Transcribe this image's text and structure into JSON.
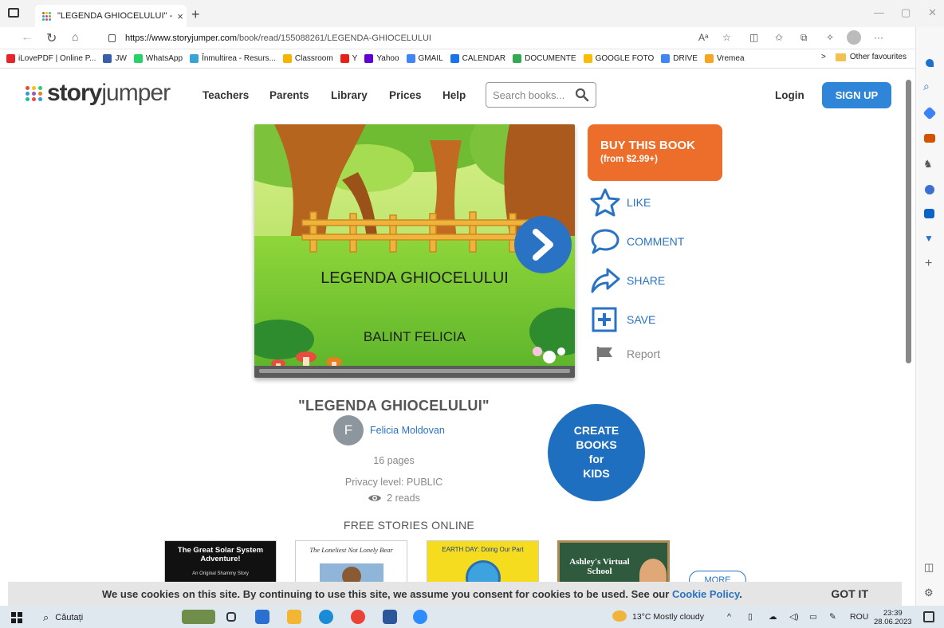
{
  "browser": {
    "tab_title": "\"LEGENDA GHIOCELULUI\" - Free",
    "tab_close": "×",
    "new_tab": "+",
    "url_host": "https://www.storyjumper.com",
    "url_path": "/book/read/155088261/LEGENDA-GHIOCELULUI",
    "bookmarks": [
      {
        "label": "iLovePDF | Online P...",
        "color": "#e5252a"
      },
      {
        "label": "JW",
        "color": "#3a5fa8"
      },
      {
        "label": "WhatsApp",
        "color": "#25d366"
      },
      {
        "label": "Înmultirea - Resurs...",
        "color": "#3aa3d6"
      },
      {
        "label": "Classroom",
        "color": "#f4b400"
      },
      {
        "label": "Y",
        "color": "#e62117"
      },
      {
        "label": "Yahoo",
        "color": "#6001d2"
      },
      {
        "label": "GMAIL",
        "color": "#4285f4"
      },
      {
        "label": "CALENDAR",
        "color": "#1a73e8"
      },
      {
        "label": "DOCUMENTE",
        "color": "#34a853"
      },
      {
        "label": "GOOGLE FOTO",
        "color": "#fbbc05"
      },
      {
        "label": "DRIVE",
        "color": "#4285f4"
      },
      {
        "label": "Vremea",
        "color": "#f5a623"
      }
    ],
    "bookmarks_more": ">",
    "other_favourites": "Other favourites"
  },
  "site": {
    "logo_part1": "story",
    "logo_part2": "jumper",
    "nav": [
      "Teachers",
      "Parents",
      "Library",
      "Prices",
      "Help"
    ],
    "search_placeholder": "Search books...",
    "login": "Login",
    "signup": "SIGN UP"
  },
  "book": {
    "cover_title": "LEGENDA GHIOCELULUI",
    "cover_author": "BALINT FELICIA",
    "heading": "\"LEGENDA GHIOCELULUI\"",
    "author_initial": "F",
    "author_name": "Felicia Moldovan",
    "pages": "16 pages",
    "privacy": "Privacy level: PUBLIC",
    "reads": "2 reads"
  },
  "actions": {
    "buy_line1": "BUY THIS BOOK",
    "buy_line2": "(from $2.99+)",
    "like": "LIKE",
    "comment": "COMMENT",
    "share": "SHARE",
    "save": "SAVE",
    "report": "Report"
  },
  "promo": {
    "line1": "CREATE",
    "line2": "BOOKS",
    "line3": "for",
    "line4": "KIDS"
  },
  "free_stories": {
    "heading": "FREE STORIES ONLINE",
    "items": [
      {
        "title": "The Great Solar System Adventure!",
        "sub": "An Original Shammy Story"
      },
      {
        "title": "The Loneliest Not Lonely Bear"
      },
      {
        "title": "EARTH DAY: Doing Our Part"
      },
      {
        "title": "Ashley's Virtual School"
      }
    ],
    "more": "MORE"
  },
  "cookie": {
    "text": "We use cookies on this site. By continuing to use this site, we assume you consent for cookies to be used. See our ",
    "link": "Cookie Policy",
    "end": ".",
    "got_it": "GOT IT"
  },
  "taskbar": {
    "search": "Căutați",
    "weather": "13°C  Mostly cloudy",
    "lang": "ROU",
    "time": "23:39",
    "date": "28.06.2023"
  }
}
